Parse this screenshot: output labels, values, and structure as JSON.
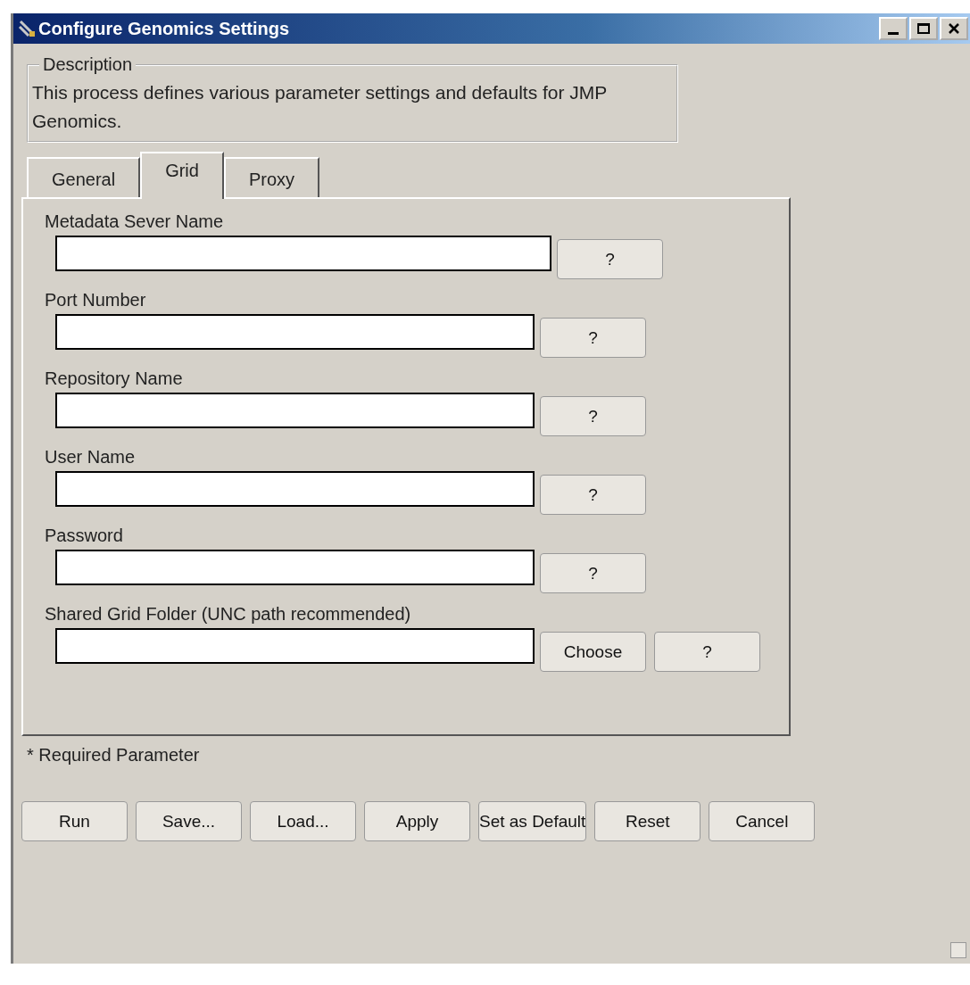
{
  "window": {
    "title": "Configure Genomics Settings"
  },
  "description": {
    "legend": "Description",
    "text": "This process defines various parameter settings and defaults for JMP Genomics."
  },
  "tabs": [
    {
      "label": "General",
      "selected": false
    },
    {
      "label": "Grid",
      "selected": true
    },
    {
      "label": "Proxy",
      "selected": false
    }
  ],
  "fields": [
    {
      "label": "Metadata Sever Name",
      "wide": true,
      "buttons": [
        "?"
      ]
    },
    {
      "label": "Port Number",
      "wide": false,
      "buttons": [
        "?"
      ]
    },
    {
      "label": "Repository Name",
      "wide": false,
      "buttons": [
        "?"
      ]
    },
    {
      "label": "User Name",
      "wide": false,
      "buttons": [
        "?"
      ]
    },
    {
      "label": "Password",
      "wide": false,
      "buttons": [
        "?"
      ]
    },
    {
      "label": "Shared Grid Folder (UNC path recommended)",
      "wide": false,
      "buttons": [
        "Choose",
        "?"
      ]
    }
  ],
  "required_note": "* Required Parameter",
  "buttons": [
    "Run",
    "Save...",
    "Load...",
    "Apply",
    "Set as Default",
    "Reset",
    "Cancel"
  ]
}
